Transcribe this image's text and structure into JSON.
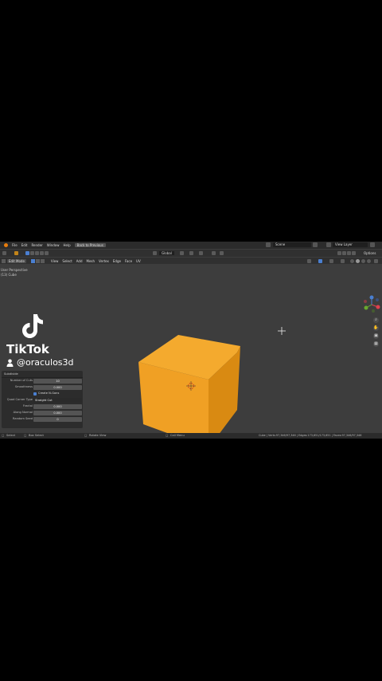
{
  "menubar": {
    "items": [
      "File",
      "Edit",
      "Render",
      "Window",
      "Help"
    ],
    "back_button": "Back to Previous",
    "scene": "Scene",
    "view_layer": "View Layer"
  },
  "toolbar_top": {
    "transform_orientation": "Global",
    "options": "Options"
  },
  "toolbar_header": {
    "mode": "Edit Mode",
    "items": [
      "View",
      "Select",
      "Add",
      "Mesh",
      "Vertex",
      "Edge",
      "Face",
      "UV"
    ]
  },
  "viewport": {
    "line1": "User Perspective",
    "line2": "(13) Cube"
  },
  "operator_panel": {
    "title": "Subdivide",
    "number_of_cuts_label": "Number of Cuts",
    "number_of_cuts": "10",
    "smoothness_label": "Smoothness",
    "smoothness": "0.000",
    "create_ngons_label": "Create N-Gons",
    "quad_corner_label": "Quad Corner Type",
    "quad_corner": "Straight Cut",
    "fractal_label": "Fractal",
    "fractal": "0.000",
    "along_normal_label": "Along Normal",
    "along_normal": "0.000",
    "random_seed_label": "Random Seed",
    "random_seed": "0"
  },
  "statusbar": {
    "select": "Select",
    "box_select": "Box Select",
    "rotate_view": "Rotate View",
    "call_menu": "Call Menu",
    "stats": "Cube | Verts:97,346/97,346 | Edges:173,651/173,651 | Faces:97,346/97,346"
  },
  "tiktok": {
    "brand": "TikTok",
    "username": "@oraculos3d"
  },
  "colors": {
    "cube_front": "#f0a024",
    "cube_top": "#f5ac31",
    "cube_side": "#d98a12",
    "viewport_bg": "#3d3d3d"
  }
}
